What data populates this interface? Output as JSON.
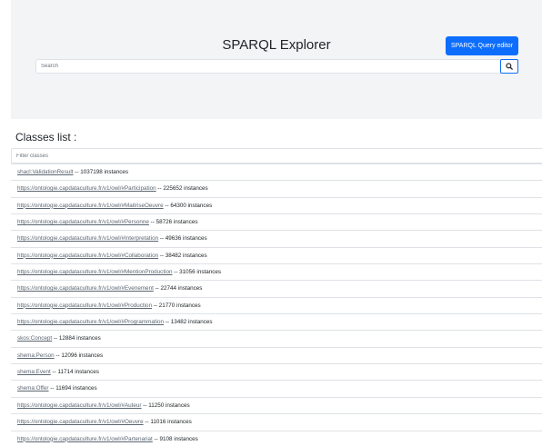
{
  "header": {
    "title": "SPARQL Explorer",
    "query_editor_label": "SPARQL Query editor",
    "search_placeholder": "Search",
    "search_icon": "magnifier-icon"
  },
  "classes": {
    "heading": "Classes list :",
    "filter_placeholder": "Filter classes",
    "separator": "--",
    "items": [
      {
        "name": "shacl:ValidationResult",
        "count": "1037198 instances"
      },
      {
        "name": "https://ontologie.capdataculture.fr/v1/owl/#Participation",
        "count": "225652 instances"
      },
      {
        "name": "https://ontologie.capdataculture.fr/v1/owl/#MaitriseOeuvre",
        "count": "64300 instances"
      },
      {
        "name": "https://ontologie.capdataculture.fr/v1/owl/#Personne",
        "count": "58726 instances"
      },
      {
        "name": "https://ontologie.capdataculture.fr/v1/owl/#Interpretation",
        "count": "49636 instances"
      },
      {
        "name": "https://ontologie.capdataculture.fr/v1/owl/#Collaboration",
        "count": "38482 instances"
      },
      {
        "name": "https://ontologie.capdataculture.fr/v1/owl/#MentionProduction",
        "count": "31056 instances"
      },
      {
        "name": "https://ontologie.capdataculture.fr/v1/owl/#Evenement",
        "count": "22744 instances"
      },
      {
        "name": "https://ontologie.capdataculture.fr/v1/owl/#Production",
        "count": "21770 instances"
      },
      {
        "name": "https://ontologie.capdataculture.fr/v1/owl/#Programmation",
        "count": "13482 instances"
      },
      {
        "name": "skos:Concept",
        "count": "12884 instances"
      },
      {
        "name": "shema:Person",
        "count": "12096 instances"
      },
      {
        "name": "shema:Event",
        "count": "11714 instances"
      },
      {
        "name": "shema:Offer",
        "count": "11694 instances"
      },
      {
        "name": "https://ontologie.capdataculture.fr/v1/owl/#Auteur",
        "count": "11250 instances"
      },
      {
        "name": "https://ontologie.capdataculture.fr/v1/owl/#Oeuvre",
        "count": "11016 instances"
      },
      {
        "name": "https://ontologie.capdataculture.fr/v1/owl/#Partenariat",
        "count": "9108 instances"
      }
    ]
  },
  "colors": {
    "accent": "#0d6efd",
    "header_bg": "#f3f4f6",
    "link": "#5a6570"
  }
}
